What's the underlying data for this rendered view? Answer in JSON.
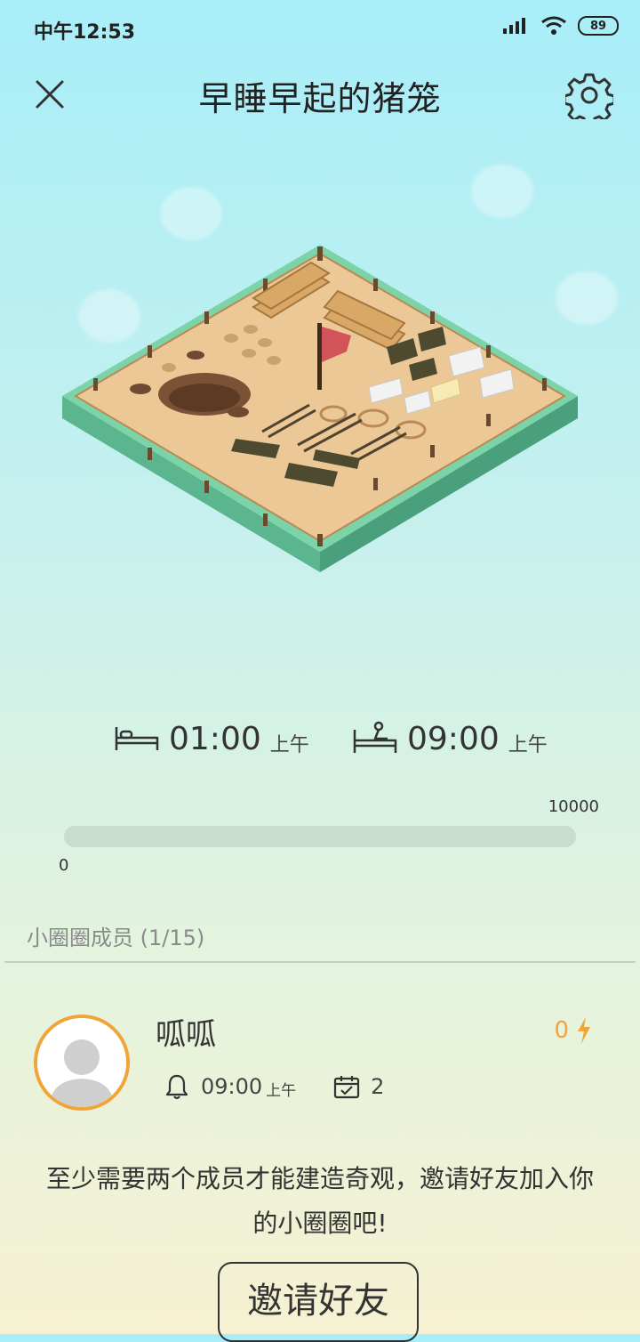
{
  "status_bar": {
    "time": "中午12:53",
    "battery": "89"
  },
  "header": {
    "title": "早睡早起的猪笼"
  },
  "sleep": {
    "bedtime": "01:00",
    "bedtime_period": "上午",
    "wake_time": "09:00",
    "wake_period": "上午"
  },
  "progress": {
    "min_label": "0",
    "max_label": "10000",
    "value": 0
  },
  "members": {
    "title": "小圈圈成员",
    "count": "(1/15)",
    "list": [
      {
        "name": "呱呱",
        "energy": "0",
        "alarm_time": "09:00",
        "alarm_period": "上午",
        "checkin_days": "2"
      }
    ]
  },
  "invite": {
    "message": "至少需要两个成员才能建造奇观，邀请好友加入你的小圈圈吧!",
    "button_label": "邀请好友"
  },
  "colors": {
    "accent_orange": "#f0a43a",
    "island_green": "#6fc79e",
    "sand": "#e9c38f"
  },
  "icons": [
    "signal-icon",
    "wifi-icon",
    "battery-icon",
    "close-icon",
    "gear-icon",
    "bed-icon",
    "wake-up-icon",
    "lightning-icon",
    "bell-icon",
    "calendar-check-icon",
    "avatar-placeholder-icon"
  ]
}
